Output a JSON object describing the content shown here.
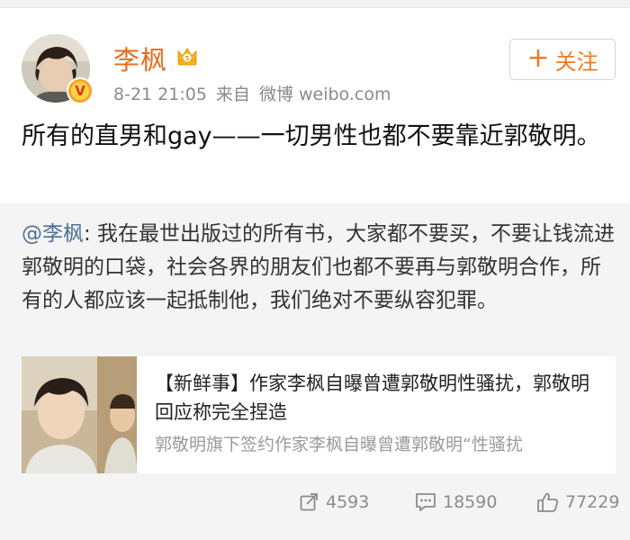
{
  "post": {
    "author": "李枫",
    "time": "8-21 21:05",
    "source_prefix": "来自",
    "source": "微博 weibo.com",
    "follow_label": "关注",
    "text": "所有的直男和gay——一切男性也都不要靠近郭敬明。",
    "icons": {
      "verified": "verified-v-icon",
      "crown": "member-crown-icon",
      "plus": "plus-icon"
    }
  },
  "repost": {
    "mention": "@李枫",
    "text": ": 我在最世出版过的所有书，大家都不要买，不要让钱流进郭敬明的口袋，社会各界的朋友们也都不要再与郭敬明合作，所有的人都应该一起抵制他，我们绝对不要纵容犯罪。",
    "card": {
      "title": "【新鲜事】作家李枫自曝曾遭郭敬明性骚扰，郭敬明回应称完全捏造",
      "summary": "郭敬明旗下签约作家李枫自曝曾遭郭敬明“性骚扰"
    }
  },
  "actions": {
    "reposts": "4593",
    "comments": "18590",
    "likes": "77229"
  },
  "colors": {
    "username": "#e86b1b",
    "follow": "#f07a22",
    "mention": "#4d6f96",
    "repost_bg": "#f4f4f4"
  }
}
